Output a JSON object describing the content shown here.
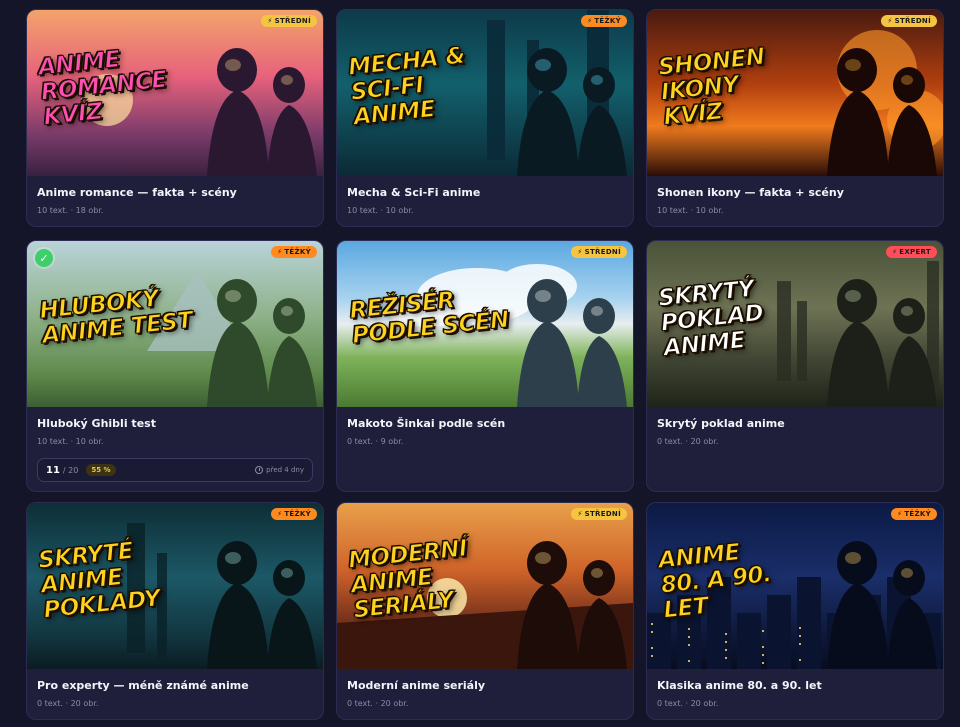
{
  "cards": [
    {
      "poster_text": "ANIME\nROMANCE\nKVÍZ",
      "poster_color": "#ff4fb3",
      "badge": "STŘEDNÍ",
      "badge_color": "#f5c542",
      "title": "Anime romance — fakta + scény",
      "meta": "10 text. · 18 obr.",
      "theme": "sunset"
    },
    {
      "poster_text": "MECHA &\nSCI-FI ANIME",
      "poster_color": "#ffd21f",
      "badge": "TĚŽKÝ",
      "badge_color": "#ff8a1f",
      "title": "Mecha & Sci-Fi anime",
      "meta": "10 text. · 10 obr.",
      "theme": "cyber"
    },
    {
      "poster_text": "SHONEN\nIKONY\nKVÍZ",
      "poster_color": "#ffd21f",
      "badge": "STŘEDNÍ",
      "badge_color": "#f5c542",
      "title": "Shonen ikony — fakta + scény",
      "meta": "10 text. · 10 obr.",
      "theme": "fire"
    },
    {
      "poster_text": "HLUBOKÝ\nANIME TEST",
      "poster_color": "#ffd21f",
      "badge": "TĚŽKÝ",
      "badge_color": "#ff8a1f",
      "title": "Hluboký Ghibli test",
      "meta": "10 text. · 10 obr.",
      "theme": "meadow",
      "completed": true,
      "progress": {
        "score": "11",
        "total": "/ 20",
        "percent": "55 %",
        "when": "před 4 dny"
      }
    },
    {
      "poster_text": "REŽISÉR\nPODLE SCÉN",
      "poster_color": "#ffd21f",
      "badge": "STŘEDNÍ",
      "badge_color": "#f5c542",
      "title": "Makoto Šinkai podle scén",
      "meta": "0 text. · 9 obr.",
      "theme": "sky"
    },
    {
      "poster_text": "SKRYTÝ\nPOKLAD\nANIME",
      "poster_color": "#ffffff",
      "badge": "EXPERT",
      "badge_color": "#ff4d5a",
      "title": "Skrytý poklad anime",
      "meta": "0 text. · 20 obr.",
      "theme": "ruins"
    },
    {
      "poster_text": "SKRYTÉ\nANIME\nPOKLADY",
      "poster_color": "#ffd21f",
      "badge": "TĚŽKÝ",
      "badge_color": "#ff8a1f",
      "title": "Pro experty — méně známé anime",
      "meta": "0 text. · 20 obr.",
      "theme": "teal"
    },
    {
      "poster_text": "MODERNÍ\nANIME SERIÁLY",
      "poster_color": "#ffd21f",
      "badge": "STŘEDNÍ",
      "badge_color": "#f5c542",
      "title": "Moderní anime seriály",
      "meta": "0 text. · 20 obr.",
      "theme": "dusk"
    },
    {
      "poster_text": "ANIME\n80. A 90. LET",
      "poster_color": "#ffd21f",
      "badge": "TĚŽKÝ",
      "badge_color": "#ff8a1f",
      "title": "Klasika anime 80. a 90. let",
      "meta": "0 text. · 20 obr.",
      "theme": "city"
    }
  ]
}
